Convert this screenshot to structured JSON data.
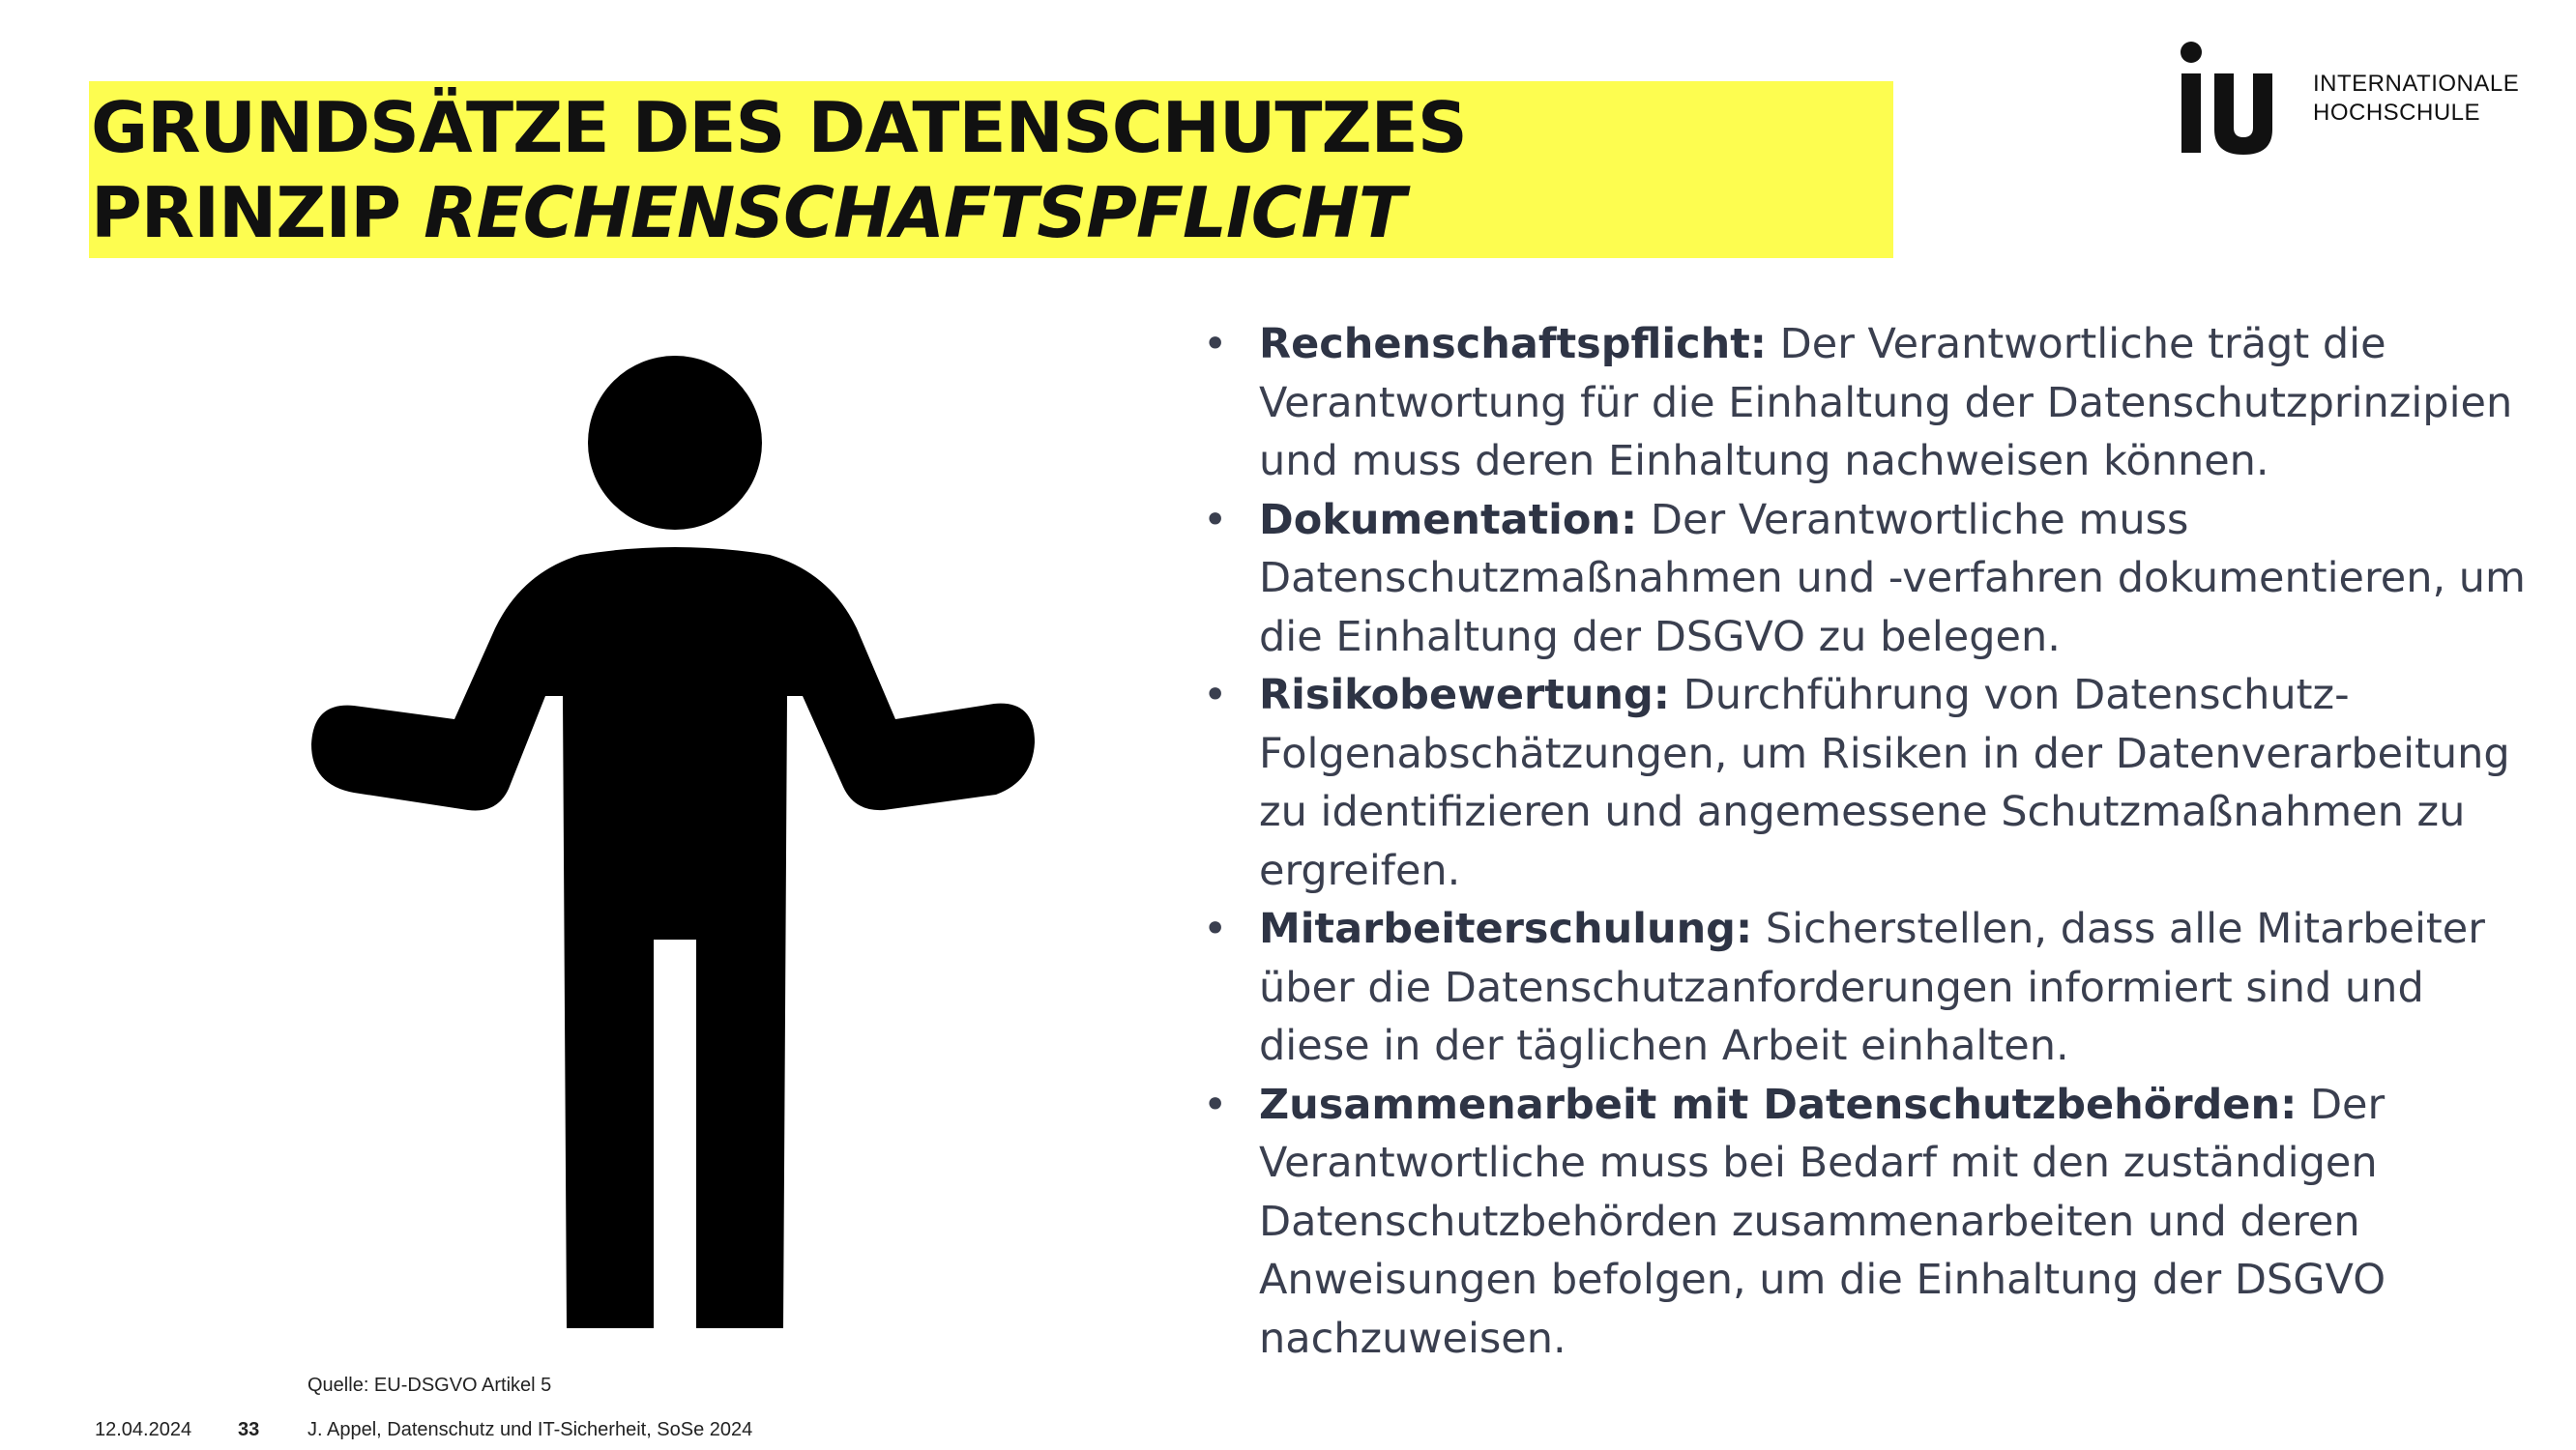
{
  "slide": {
    "title_line1": "GRUNDSÄTZE DES DATENSCHUTZES",
    "title_line2_prefix": "PRINZIP ",
    "title_line2_italic": "RECHENSCHAFTSPFLICHT",
    "title_background": "#fdfd50"
  },
  "logo": {
    "mark_icon": "iu-logo-mark",
    "line1": "INTERNATIONALE",
    "line2": "HOCHSCHULE"
  },
  "illustration": {
    "icon": "person-shrugging-icon"
  },
  "bullets": [
    {
      "term": "Rechenschaftspflicht:",
      "text": " Der Verantwortliche trägt die Verantwortung für die Einhaltung der Datenschutzprinzipien und muss deren Einhaltung nachweisen können."
    },
    {
      "term": "Dokumentation:",
      "text": " Der Verantwortliche muss Datenschutzmaßnahmen und -verfahren dokumentieren, um die Einhaltung der DSGVO zu belegen."
    },
    {
      "term": "Risikobewertung:",
      "text": " Durchführung von Datenschutz-Folgenabschätzungen, um Risiken in der Datenverarbeitung zu identifizieren und angemessene Schutzmaßnahmen zu ergreifen."
    },
    {
      "term": "Mitarbeiterschulung:",
      "text": " Sicherstellen, dass alle Mitarbeiter über die Datenschutzanforderungen informiert sind und diese in der täglichen Arbeit einhalten."
    },
    {
      "term": "Zusammenarbeit mit Datenschutzbehörden:",
      "text": " Der Verantwortliche muss bei Bedarf mit den zuständigen Datenschutzbehörden zusammenarbeiten und deren Anweisungen befolgen, um die Einhaltung der DSGVO nachzuweisen."
    }
  ],
  "bullet_symbol": "•",
  "source": "Quelle: EU-DSGVO Artikel 5",
  "footer": {
    "date": "12.04.2024",
    "page": "33",
    "course": "J. Appel, Datenschutz und IT-Sicherheit, SoSe 2024"
  }
}
